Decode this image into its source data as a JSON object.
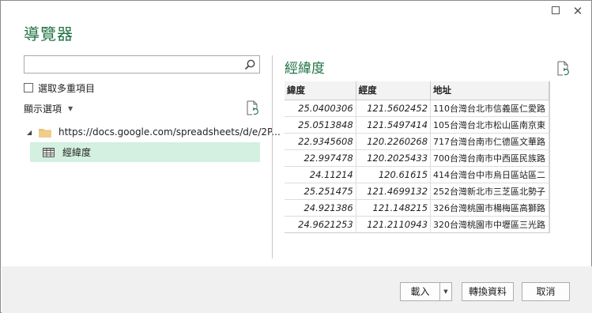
{
  "window": {
    "title": "導覽器",
    "maximize_icon": "maximize-icon",
    "close_glyph": "✕"
  },
  "search": {
    "value": "",
    "placeholder": "",
    "icon": "search-icon"
  },
  "multi_select": {
    "label": "選取多重項目",
    "checked": false
  },
  "display_options": {
    "label": "顯示選項",
    "caret": "▼"
  },
  "tree": {
    "root": {
      "label": "https://docs.google.com/spreadsheets/d/e/2P...",
      "icon": "folder-icon",
      "expanded": true,
      "arrow": "◢"
    },
    "items": [
      {
        "label": "經緯度",
        "icon": "table-icon",
        "selected": true
      }
    ]
  },
  "preview": {
    "title": "經緯度",
    "columns": [
      "緯度",
      "經度",
      "地址"
    ],
    "rows": [
      [
        "25.0400306",
        "121.5602452",
        "110台灣台北市信義區仁愛路"
      ],
      [
        "25.0513848",
        "121.5497414",
        "105台灣台北市松山區南京東"
      ],
      [
        "22.9345608",
        "120.2260268",
        "717台灣台南市仁德區文華路"
      ],
      [
        "22.997478",
        "120.2025433",
        "700台灣台南市中西區民族路"
      ],
      [
        "24.11214",
        "120.61615",
        "414台灣台中市烏日區站區二"
      ],
      [
        "25.251475",
        "121.4699132",
        "252台灣新北市三芝區北勢子"
      ],
      [
        "24.921386",
        "121.148215",
        "326台灣桃園市楊梅區高獅路"
      ],
      [
        "24.9621253",
        "121.2110943",
        "320台灣桃園市中壢區三光路"
      ]
    ]
  },
  "buttons": {
    "load": "載入",
    "load_dropdown": "▼",
    "transform": "轉換資料",
    "cancel": "取消"
  },
  "colors": {
    "accent": "#217346",
    "selected_row": "#d3f0e0",
    "footer_bg": "#f0f0f0"
  }
}
